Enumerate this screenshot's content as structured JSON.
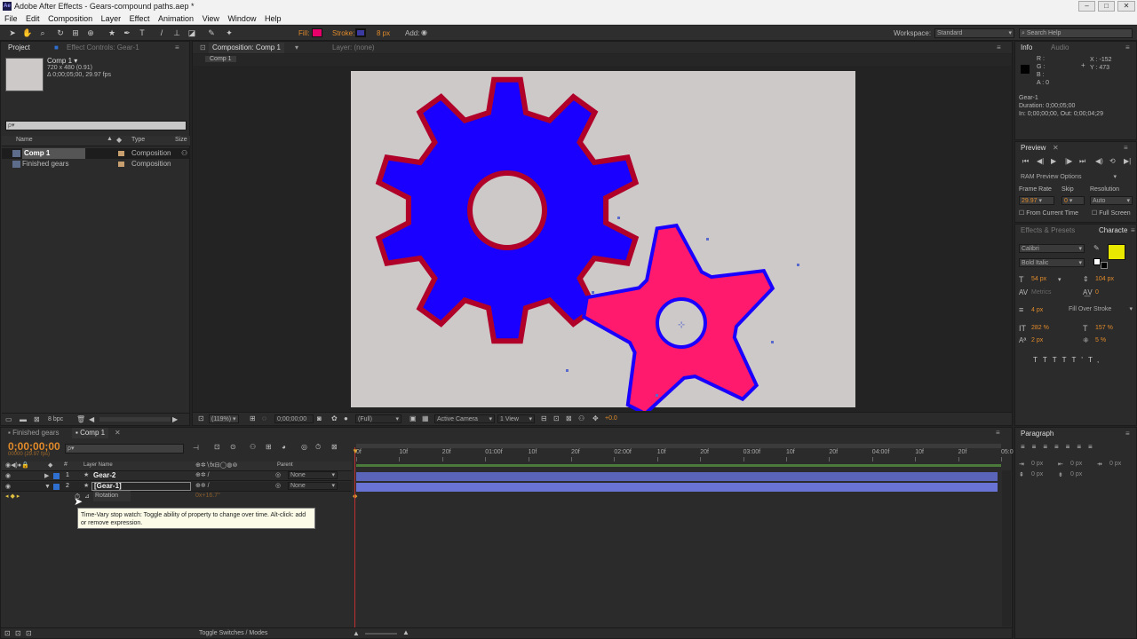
{
  "app": {
    "title": "Adobe After Effects - Gears-compound paths.aep *",
    "icon": "Ae",
    "menus": [
      "File",
      "Edit",
      "Composition",
      "Layer",
      "Effect",
      "Animation",
      "View",
      "Window",
      "Help"
    ]
  },
  "toolbar": {
    "fill_label": "Fill:",
    "fill_color": "#e8006a",
    "stroke_label": "Stroke:",
    "stroke_color": "#3a3aa0",
    "stroke_width": "8 px",
    "add_label": "Add:",
    "workspace_label": "Workspace:",
    "workspace_value": "Standard",
    "search_placeholder": "Search Help"
  },
  "project_panel": {
    "tab_project": "Project",
    "tab_effect_controls": "Effect Controls: Gear-1",
    "comp_name": "Comp 1 ▾",
    "comp_size": "720 x 480 (0.91)",
    "comp_duration": "Δ 0;00;05;00, 29.97 fps",
    "search_placeholder": "ρ▾",
    "col_name": "Name",
    "col_type": "Type",
    "col_size": "Size",
    "items": [
      {
        "name": "Comp 1",
        "type": "Composition"
      },
      {
        "name": "Finished gears",
        "type": "Composition"
      }
    ],
    "bpc": "8 bpc"
  },
  "comp_panel": {
    "tab_comp": "Composition: Comp 1",
    "tab_layer": "Layer: (none)",
    "breadcrumb": "Comp 1",
    "zoom": "(119%)",
    "timecode": "0;00;00;00",
    "resolution": "(Full)",
    "camera": "Active Camera",
    "views": "1 View",
    "exposure": "+0.0",
    "colors": {
      "canvas": "#cdc9c9",
      "big_gear_fill": "#1a00ff",
      "big_gear_stroke": "#b0002a",
      "small_gear_fill": "#ff1a6e",
      "small_gear_stroke": "#1a00ff"
    }
  },
  "info_panel": {
    "tab_info": "Info",
    "tab_audio": "Audio",
    "r": "R :",
    "g": "G :",
    "b": "B :",
    "a": "A : 0",
    "x": "X : -152",
    "y": "Y : 473",
    "layer_name": "Gear-1",
    "duration": "Duration: 0;00;05;00",
    "in_out": "In: 0;00;00;00, Out: 0;00;04;29"
  },
  "preview_panel": {
    "tab": "Preview",
    "ram_options": "RAM Preview Options",
    "frame_rate_label": "Frame Rate",
    "skip_label": "Skip",
    "resolution_label": "Resolution",
    "frame_rate": "29.97",
    "skip": "0",
    "resolution": "Auto",
    "from_current": "From Current Time",
    "full_screen": "Full Screen"
  },
  "character_panel": {
    "tab_effects": "Effects & Presets",
    "tab_character": "Characte",
    "font": "Calibri",
    "style": "Bold Italic",
    "size": "54 px",
    "leading": "104 px",
    "kerning": "Metrics",
    "tracking": "0",
    "stroke_width": "4 px",
    "stroke_type": "Fill Over Stroke",
    "vscale": "282 %",
    "hscale": "157 %",
    "baseline": "2 px",
    "tsume": "5 %",
    "fill_color": "#e8e800"
  },
  "paragraph_panel": {
    "tab": "Paragraph",
    "indent_left": "0 px",
    "indent_right": "0 px",
    "indent_first": "0 px",
    "space_before": "0 px",
    "space_after": "0 px"
  },
  "timeline": {
    "tab_finished": "Finished gears",
    "tab_comp": "Comp 1",
    "timecode": "0;00;00;00",
    "fps": "00000 (29.97 fps)",
    "search_placeholder": "ρ▾",
    "col_layer_name": "Layer Name",
    "col_parent": "Parent",
    "layers": [
      {
        "num": "1",
        "name": "Gear-2",
        "parent": "None"
      },
      {
        "num": "2",
        "name": "[Gear-1]",
        "parent": "None"
      }
    ],
    "property_name": "Rotation",
    "property_value": "0x+16.7°",
    "ruler": [
      "0f",
      "10f",
      "20f",
      "01:00f",
      "10f",
      "20f",
      "02:00f",
      "10f",
      "20f",
      "03:00f",
      "10f",
      "20f",
      "04:00f",
      "10f",
      "20f",
      "05:0"
    ],
    "tooltip": "Time-Vary stop watch: Toggle ability of property to change over time. Alt-click: add or remove expression.",
    "toggle_modes": "Toggle Switches / Modes",
    "bar_color": "#5a64b8"
  }
}
